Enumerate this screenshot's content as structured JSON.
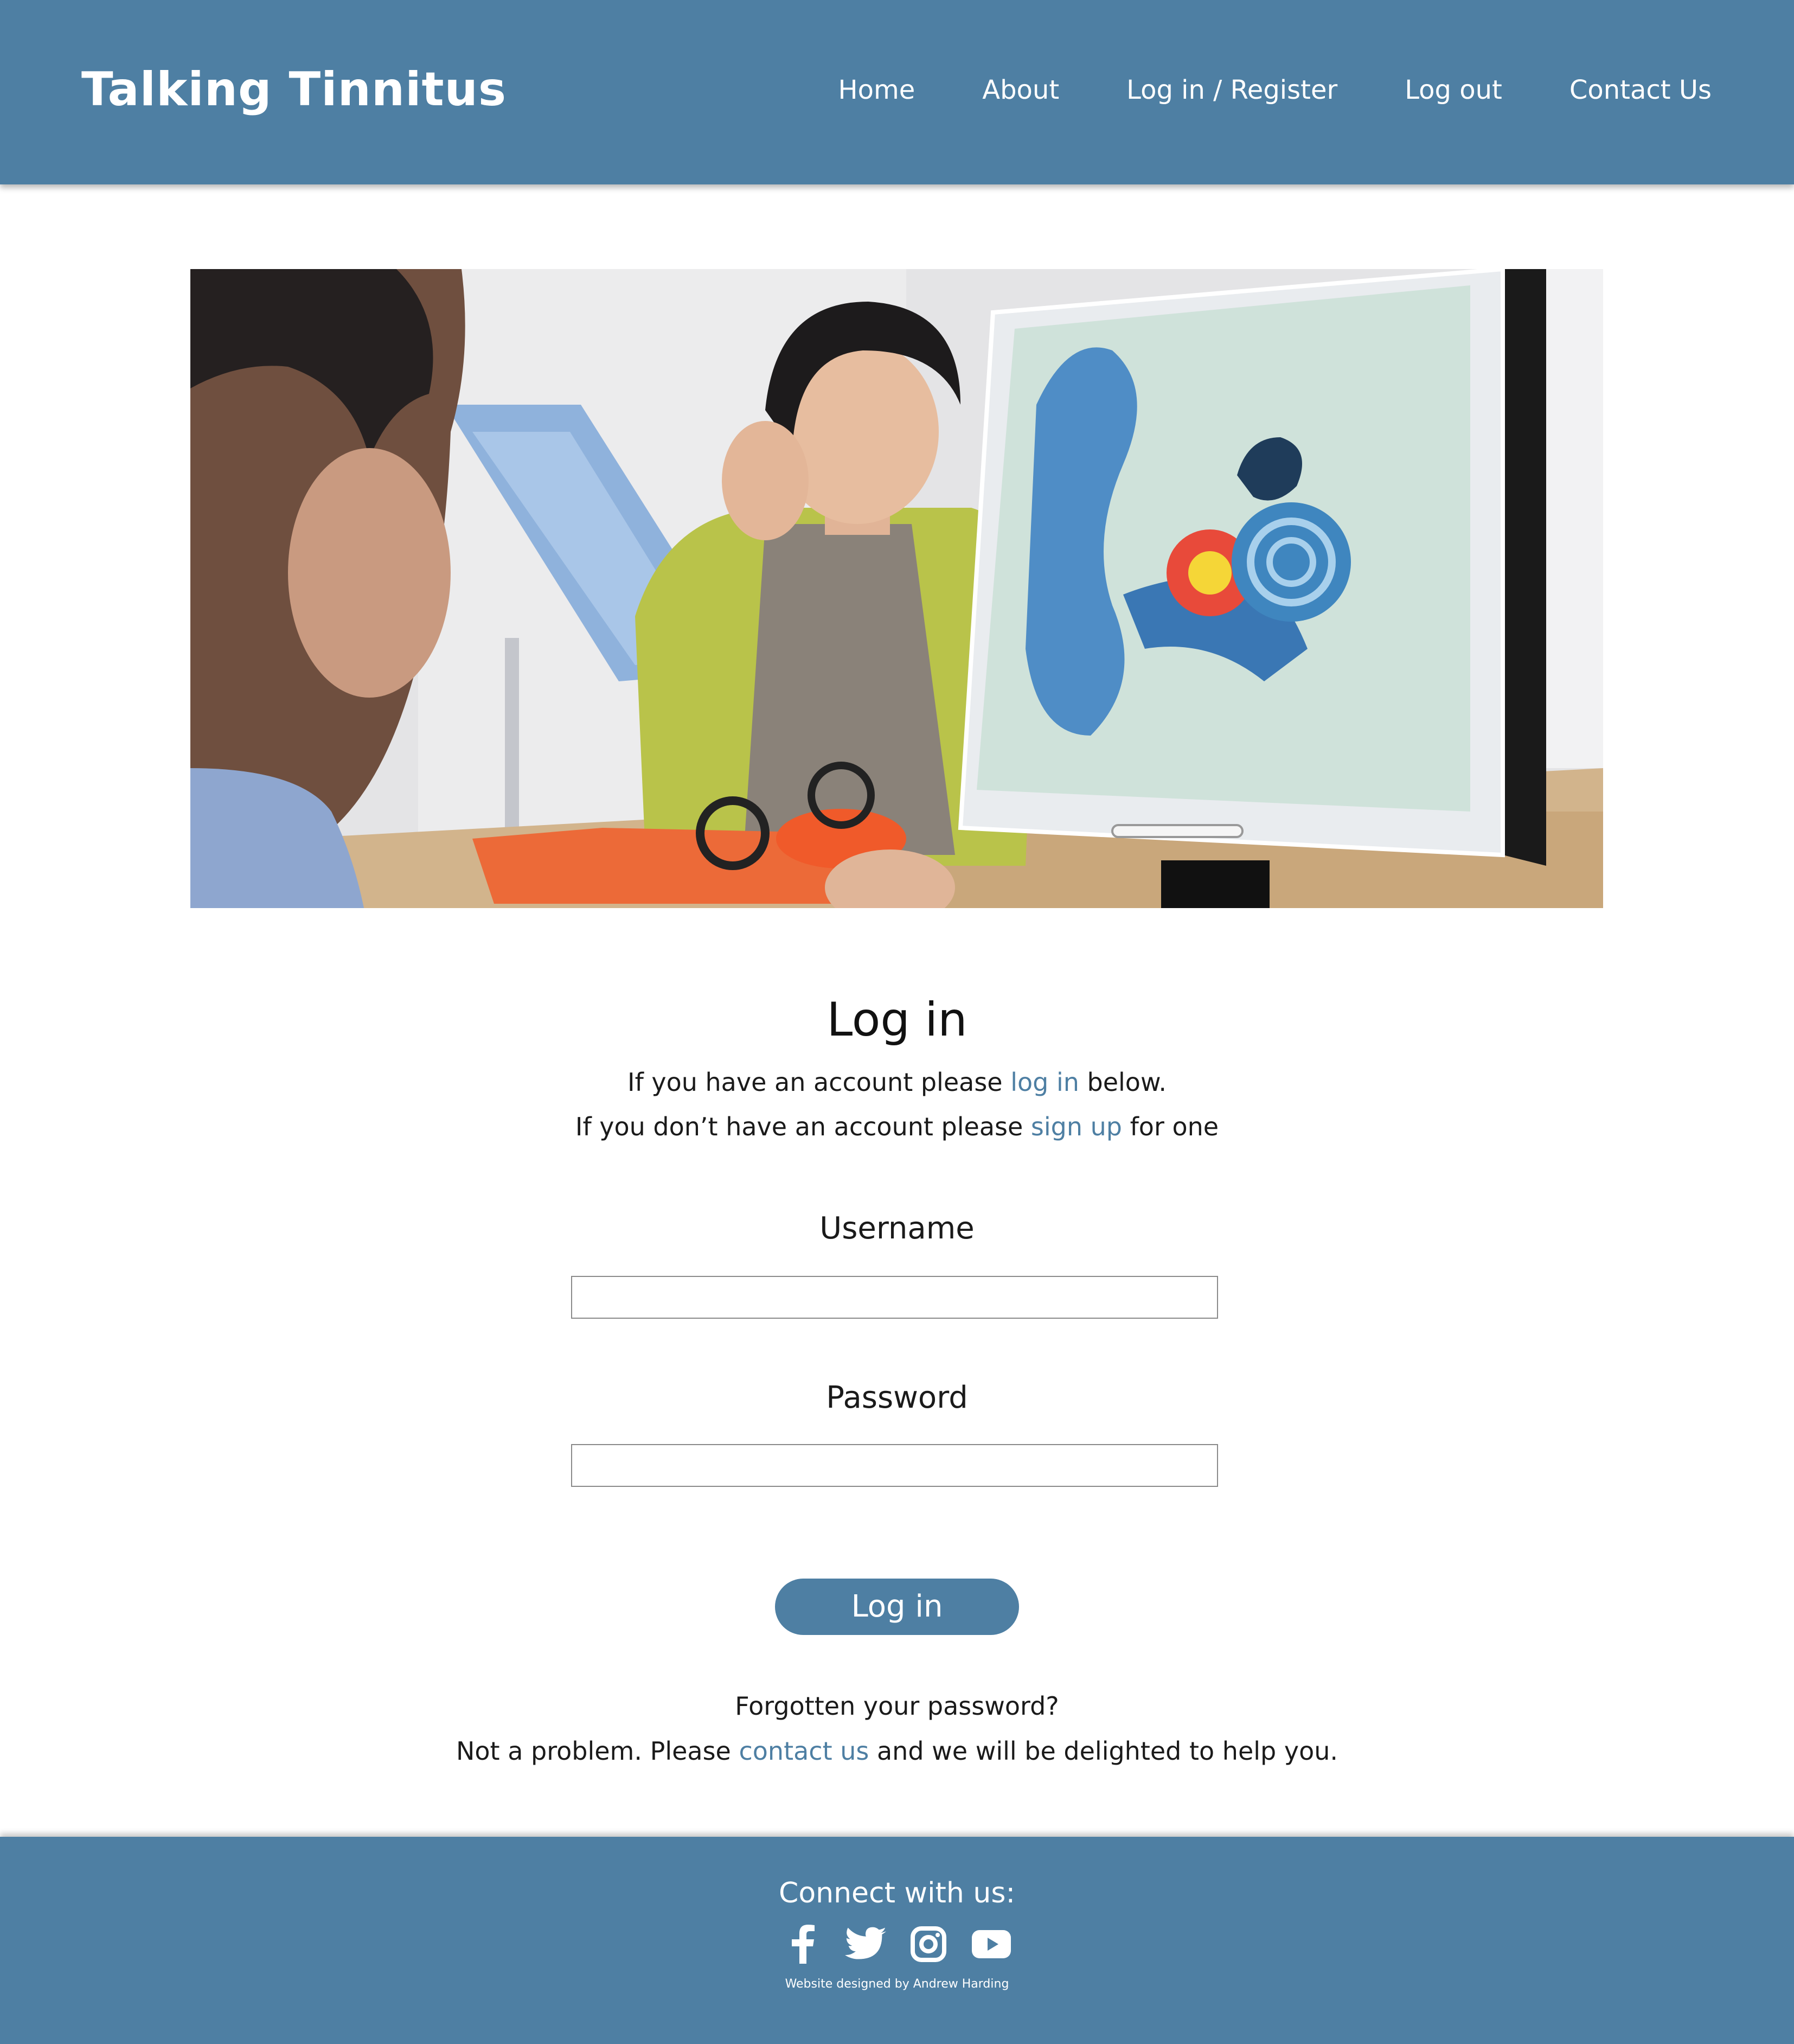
{
  "header": {
    "brand": "Talking Tinnitus",
    "nav": [
      "Home",
      "About",
      "Log in / Register",
      "Log out",
      "Contact Us"
    ]
  },
  "hero": {
    "alt": "Doctor showing a patient an ear anatomy illustration on a monitor"
  },
  "login": {
    "title": "Log in",
    "intro_line1_before": "If you have an account please ",
    "intro_line1_link": "log in",
    "intro_line1_after": " below.",
    "intro_line2_before": "If you don’t have an account please ",
    "intro_line2_link": "sign up",
    "intro_line2_after": " for one",
    "username_label": "Username",
    "username_value": "",
    "password_label": "Password",
    "password_value": "",
    "submit_label": "Log in",
    "forgot_line": "Forgotten your password?",
    "help_before": "Not a problem. Please ",
    "help_link": "contact us",
    "help_after": " and we will be delighted to help you."
  },
  "footer": {
    "connect": "Connect with us:",
    "socials": [
      "facebook-icon",
      "twitter-icon",
      "instagram-icon",
      "youtube-icon"
    ],
    "credit": "Website designed by Andrew Harding"
  },
  "colors": {
    "brand_blue": "#4e7fa3",
    "text": "#1a1a1a",
    "background": "#ffffff"
  }
}
